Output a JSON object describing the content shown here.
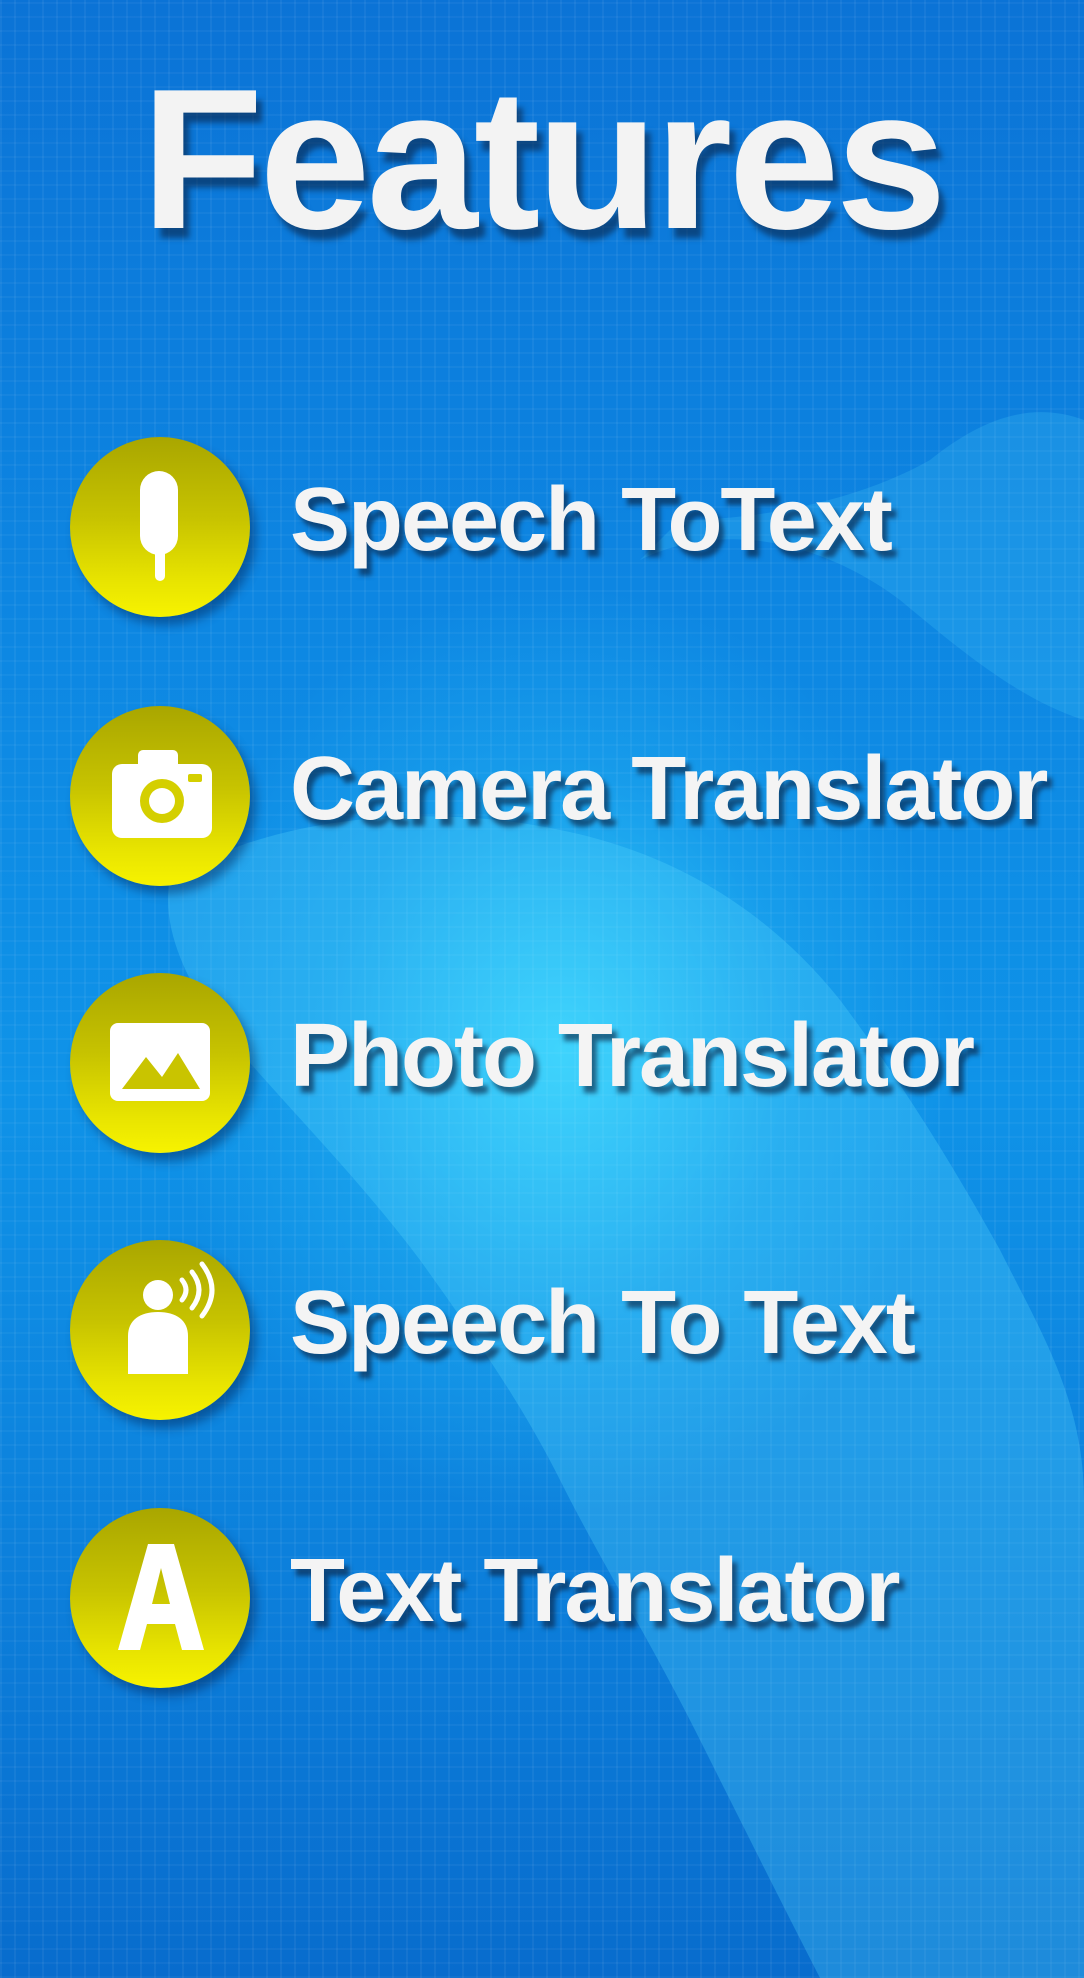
{
  "title": "Features",
  "colors": {
    "background": "#0d86e2",
    "icon_circle": "#d9d500",
    "text": "#f4f4f4"
  },
  "features": [
    {
      "label": "Speech ToText",
      "icon": "microphone-icon"
    },
    {
      "label": "Camera Translator",
      "icon": "camera-icon"
    },
    {
      "label": "Photo Translator",
      "icon": "image-icon"
    },
    {
      "label": "Speech To Text",
      "icon": "speaking-person-icon"
    },
    {
      "label": "Text Translator",
      "icon": "letter-a-icon"
    }
  ]
}
